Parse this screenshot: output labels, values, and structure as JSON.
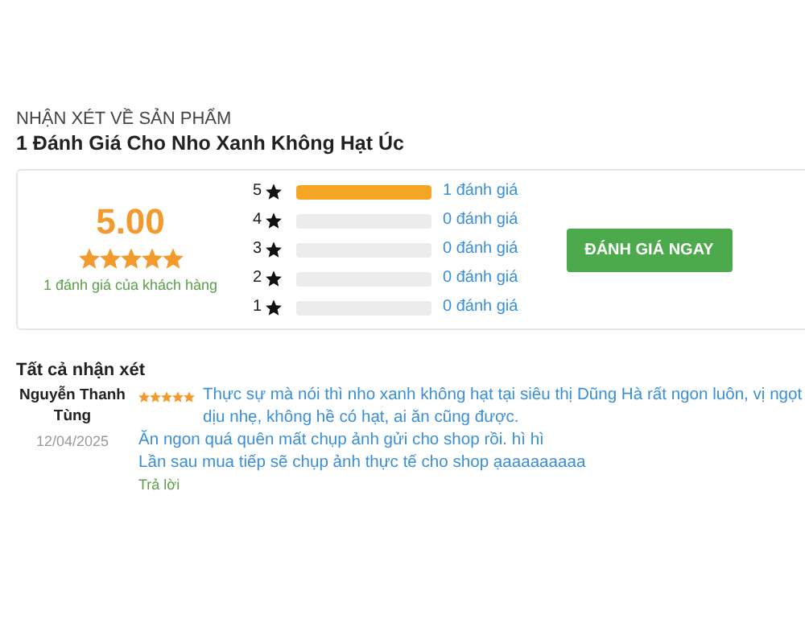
{
  "section_label": "NHẬN XÉT VỀ SẢN PHẨM",
  "title": "1 Đánh Giá Cho Nho Xanh Không Hạt Úc",
  "summary": {
    "score": "5.00",
    "stars": 5,
    "caption": "1 đánh giá của khách hàng"
  },
  "breakdown": [
    {
      "label": "5",
      "level": 1,
      "count": "1 đánh giá"
    },
    {
      "label": "4",
      "level": 0,
      "count": "0 đánh giá"
    },
    {
      "label": "3",
      "level": 0,
      "count": "0 đánh giá"
    },
    {
      "label": "2",
      "level": 0,
      "count": "0 đánh giá"
    },
    {
      "label": "1",
      "level": 0,
      "count": "0 đánh giá"
    }
  ],
  "rate_button": "ĐÁNH GIÁ NGAY",
  "reviews_heading": "Tất cả nhận xét",
  "reviews": [
    {
      "author": "Nguyễn Thanh Tùng",
      "date": "12/04/2025",
      "stars": 5,
      "paragraphs": [
        "Thực sự mà nói thì nho xanh không hạt tại siêu thị Dũng Hà rất ngon luôn, vị ngọt dịu nhẹ, không hề có hạt, ai ăn cũng được.",
        "Ăn ngon quá quên mất chụp ảnh gửi cho shop rồi. hì hì",
        "Lần sau mua tiếp sẽ chụp ảnh thực tế cho shop ạaaaaaaaaa"
      ],
      "reply": "Trả lời"
    }
  ]
}
